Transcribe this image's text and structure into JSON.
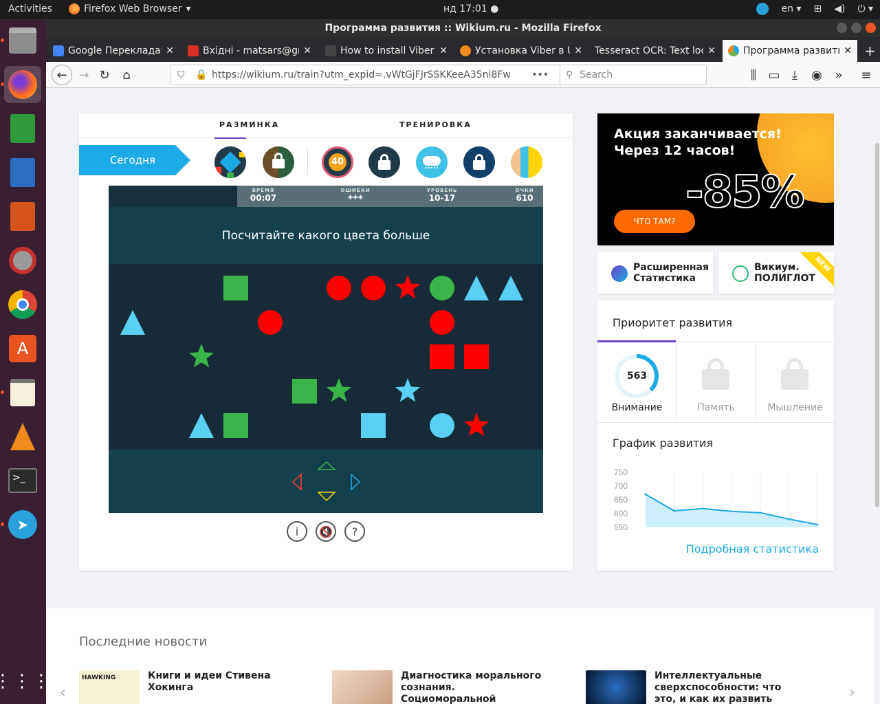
{
  "top_bar": {
    "activities": "Activities",
    "app_name": "Firefox Web Browser",
    "clock": "нд 17:01",
    "lang": "en"
  },
  "window": {
    "title": "Программа развития :: Wikium.ru - Mozilla Firefox"
  },
  "dock": [
    "Files",
    "Firefox",
    "LibreOffice Calc",
    "LibreOffice Writer",
    "LibreOffice Impress",
    "System Tools",
    "Chrome",
    "Ubuntu Software",
    "Text Editor",
    "VLC",
    "Terminal",
    "Telegram",
    "Show Applications"
  ],
  "tabs": [
    {
      "title": "Google Перекладач",
      "color": "#4285f4"
    },
    {
      "title": "Вхідні - matsars@gmail.com",
      "color": "#d93025"
    },
    {
      "title": "How to install Viber on Ubuntu",
      "color": "#444444"
    },
    {
      "title": "Установка Viber в Ubuntu",
      "color": "#f08a1c"
    },
    {
      "title": "Tesseract OCR: Text localization",
      "color": "#666666"
    },
    {
      "title": "Программа развития",
      "color": "#6ab04c"
    }
  ],
  "nav": {
    "url": "https://wikium.ru/train?utm_expid=.vWtGjFJrSSKKeeA35ni8Fw",
    "search_placeholder": "Search"
  },
  "main": {
    "tabs": [
      "РАЗМИНКА",
      "ТРЕНИРОВКА"
    ],
    "today": "Сегодня",
    "badge_count": "40",
    "hud": [
      {
        "label": "ВРЕМЯ",
        "value": "00:07"
      },
      {
        "label": "ОШИБКИ",
        "value": "✚✚✚"
      },
      {
        "label": "УРОВЕНЬ",
        "value": "10-17"
      },
      {
        "label": "ОЧКИ",
        "value": "610"
      }
    ],
    "question": "Посчитайте какого цвета больше",
    "shapes": [
      {
        "type": "square",
        "color": "#3ab54a",
        "row": 0,
        "col": 3
      },
      {
        "type": "circle",
        "color": "#ff0000",
        "row": 0,
        "col": 6
      },
      {
        "type": "circle",
        "color": "#ff0000",
        "row": 0,
        "col": 7
      },
      {
        "type": "star",
        "color": "#ff0000",
        "row": 0,
        "col": 8
      },
      {
        "type": "circle",
        "color": "#3ab54a",
        "row": 0,
        "col": 9
      },
      {
        "type": "triangle",
        "color": "#5ad0f5",
        "row": 0,
        "col": 10
      },
      {
        "type": "triangle",
        "color": "#5ad0f5",
        "row": 0,
        "col": 11
      },
      {
        "type": "triangle",
        "color": "#5ad0f5",
        "row": 1,
        "col": 0
      },
      {
        "type": "circle",
        "color": "#ff0000",
        "row": 1,
        "col": 4
      },
      {
        "type": "circle",
        "color": "#ff0000",
        "row": 1,
        "col": 9
      },
      {
        "type": "star",
        "color": "#3ab54a",
        "row": 2,
        "col": 2
      },
      {
        "type": "square",
        "color": "#ff0000",
        "row": 2,
        "col": 9
      },
      {
        "type": "square",
        "color": "#ff0000",
        "row": 2,
        "col": 10
      },
      {
        "type": "square",
        "color": "#3ab54a",
        "row": 3,
        "col": 5
      },
      {
        "type": "star",
        "color": "#3ab54a",
        "row": 3,
        "col": 6
      },
      {
        "type": "star",
        "color": "#5ad0f5",
        "row": 3,
        "col": 8
      },
      {
        "type": "triangle",
        "color": "#5ad0f5",
        "row": 4,
        "col": 2
      },
      {
        "type": "square",
        "color": "#3ab54a",
        "row": 4,
        "col": 3
      },
      {
        "type": "square",
        "color": "#5ad0f5",
        "row": 4,
        "col": 7
      },
      {
        "type": "circle",
        "color": "#5ad0f5",
        "row": 4,
        "col": 9
      },
      {
        "type": "star",
        "color": "#ff0000",
        "row": 4,
        "col": 10
      }
    ],
    "controls": {
      "info": "i",
      "mute": "🔇",
      "help": "?"
    }
  },
  "promo": {
    "title_line1": "Акция заканчивается!",
    "title_line2": "Через 12 часов!",
    "discount": "-85%",
    "button": "ЧТО ТАМ?"
  },
  "features": [
    {
      "line1": "Расширенная",
      "line2": "Статистика"
    },
    {
      "line1": "Викиум.",
      "line2": "ПОЛИГЛОТ",
      "badge": "NEW"
    }
  ],
  "priority": {
    "title": "Приоритет развития",
    "attention_value": "563",
    "skills": [
      "Внимание",
      "Память",
      "Мышление"
    ],
    "graph_title": "График развития",
    "more_link": "Подробная статистика"
  },
  "chart_data": {
    "type": "area",
    "title": "График развития",
    "y_ticks": [
      "750",
      "700",
      "650",
      "600",
      "550"
    ],
    "ylim": [
      550,
      750
    ],
    "values": [
      670,
      610,
      618,
      608,
      603,
      580,
      560
    ],
    "color": "#1eaae7"
  },
  "news": {
    "heading": "Последние новости",
    "items": [
      {
        "title": "Книги и идеи Стивена Хокинга",
        "img_text": "HAWKING"
      },
      {
        "title": "Диагностика морального сознания. Социоморальной рефлексии диагностика –..."
      },
      {
        "title": "Интеллектуальные сверхспособности: что это, и как их развить"
      }
    ]
  }
}
